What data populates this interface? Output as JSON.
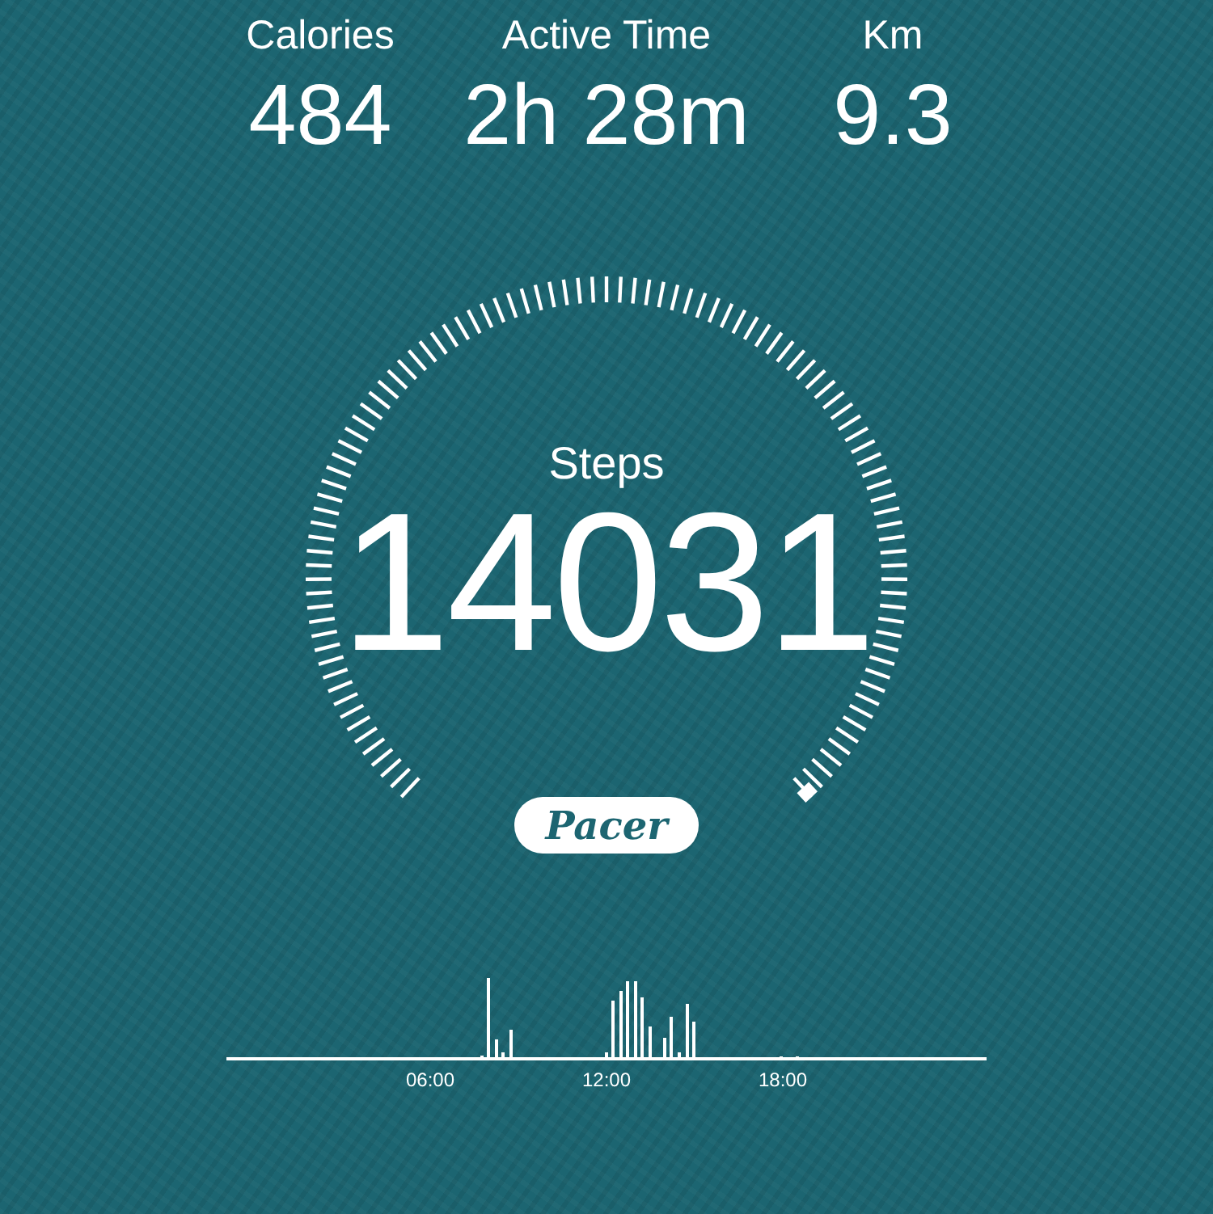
{
  "stats": [
    {
      "label": "Calories",
      "value": "484"
    },
    {
      "label": "Active Time",
      "value": "2h 28m"
    },
    {
      "label": "Km",
      "value": "9.3"
    }
  ],
  "gauge": {
    "label": "Steps",
    "value": "14031"
  },
  "logo": "Pacer",
  "activity_chart": {
    "time_labels": [
      "06:00",
      "12:00",
      "18:00"
    ]
  }
}
